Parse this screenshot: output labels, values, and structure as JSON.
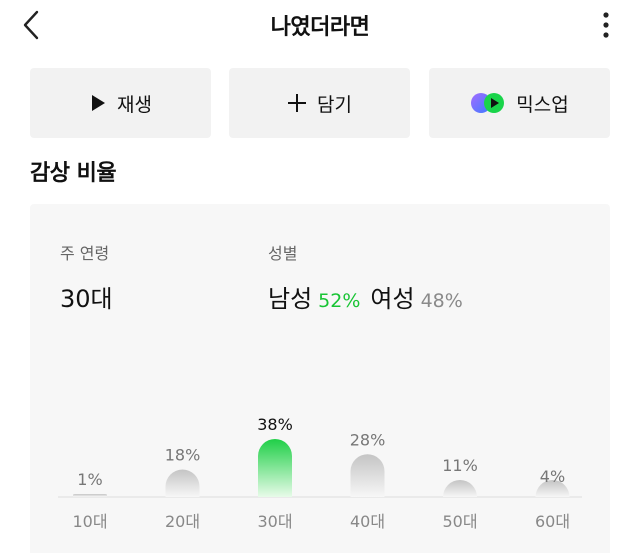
{
  "header": {
    "title": "나였더라면"
  },
  "actions": {
    "play_label": "재생",
    "add_label": "담기",
    "mixup_label": "믹스업"
  },
  "section": {
    "title": "감상 비율"
  },
  "stats": {
    "age_label": "주 연령",
    "age_value": "30대",
    "gender_label": "성별",
    "male_label": "남성",
    "male_pct": "52%",
    "female_label": "여성",
    "female_pct": "48%"
  },
  "colors": {
    "accent_green": "#18c434",
    "highlight_bar": "#1fcf47"
  },
  "chart_data": {
    "type": "bar",
    "categories": [
      "10대",
      "20대",
      "30대",
      "40대",
      "50대",
      "60대"
    ],
    "values": [
      1,
      18,
      38,
      28,
      11,
      4
    ],
    "value_labels": [
      "1%",
      "18%",
      "38%",
      "28%",
      "11%",
      "4%"
    ],
    "highlight_index": 2,
    "grid": false
  }
}
